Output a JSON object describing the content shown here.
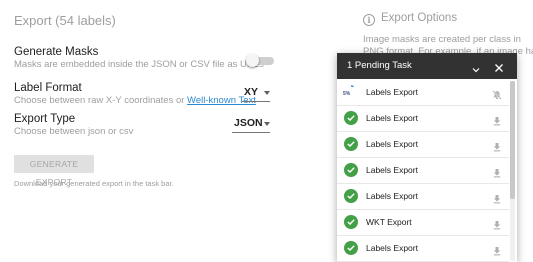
{
  "page": {
    "title": "Export (54 labels)"
  },
  "masks": {
    "label": "Generate Masks",
    "description": "Masks are embedded inside the JSON or CSV file as URLs",
    "enabled": false
  },
  "label_format": {
    "label": "Label Format",
    "description_prefix": "Choose between raw X-Y coordinates or ",
    "description_link": "Well-known Text",
    "value": "XY"
  },
  "export_type": {
    "label": "Export Type",
    "description": "Choose between json or csv",
    "value": "JSON"
  },
  "generate_button": {
    "label": "GENERATE EXPORT"
  },
  "hint": "Download your generated export in the task bar.",
  "export_options": {
    "icon": "info-icon",
    "title": "Export Options",
    "line1": "Image masks are created per class in",
    "line2": "PNG format. For example, if an image has"
  },
  "tasks_panel": {
    "title": "1 Pending Task",
    "collapse_icon": "chevron-down-icon",
    "close_icon": "close-icon",
    "tasks": [
      {
        "name": "Labels Export",
        "status": "pending",
        "progress_label": "5%",
        "progress": 0.05,
        "action_icon": "notifications-off-icon"
      },
      {
        "name": "Labels Export",
        "status": "done",
        "action_icon": "download-icon"
      },
      {
        "name": "Labels Export",
        "status": "done",
        "action_icon": "download-icon"
      },
      {
        "name": "Labels Export",
        "status": "done",
        "action_icon": "download-icon"
      },
      {
        "name": "Labels Export",
        "status": "done",
        "action_icon": "download-icon"
      },
      {
        "name": "WKT Export",
        "status": "done",
        "action_icon": "download-icon"
      },
      {
        "name": "Labels Export",
        "status": "done",
        "action_icon": "download-icon"
      }
    ]
  },
  "colors": {
    "accent_link": "#2a8bd0",
    "success_green": "#43a047",
    "panel_header": "#323232"
  }
}
